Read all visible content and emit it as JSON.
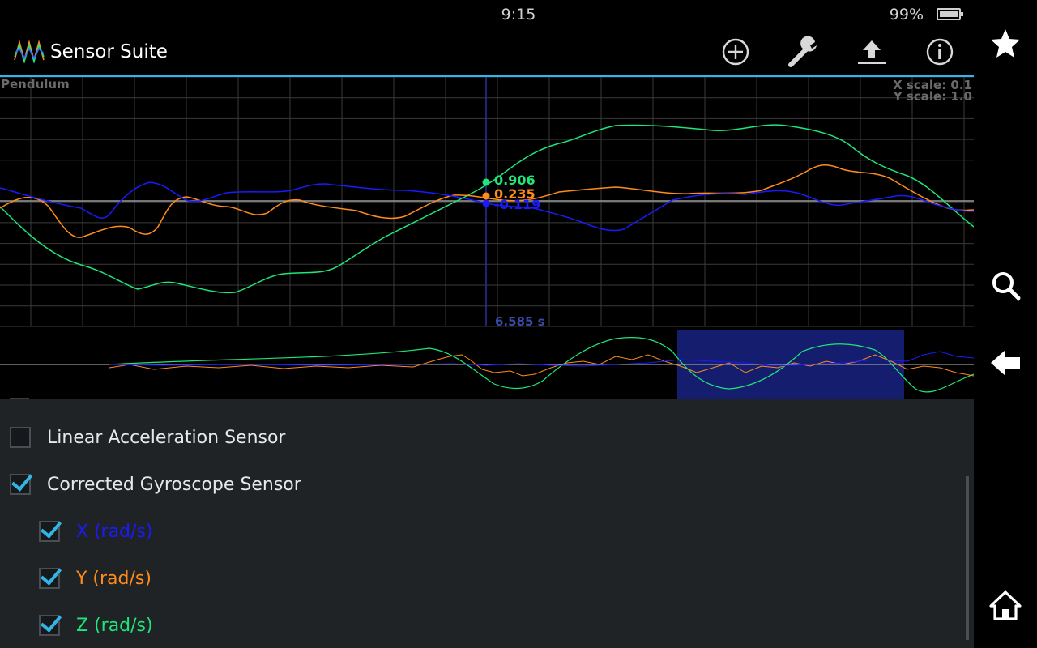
{
  "status": {
    "time": "9:15",
    "battery": "99%"
  },
  "app": {
    "title": "Sensor Suite"
  },
  "graph": {
    "title": "Pendulum",
    "x_scale": "X scale: 0.1",
    "y_scale": "Y scale: 1.0",
    "cursor_time": "6.585 s",
    "readouts": {
      "z": "0.906",
      "y": "0.235",
      "x": "-0.119"
    }
  },
  "colors": {
    "x": "#1a1aff",
    "y": "#ff8c1a",
    "z": "#1ee67a",
    "accent": "#33b5e5"
  },
  "sensors": [
    {
      "label": "Linear Acceleration Sensor",
      "checked": false
    },
    {
      "label": "Corrected Gyroscope Sensor",
      "checked": true
    }
  ],
  "axes": [
    {
      "label": "X (rad/s)",
      "checked": true
    },
    {
      "label": "Y (rad/s)",
      "checked": true
    },
    {
      "label": "Z (rad/s)",
      "checked": true
    }
  ],
  "icons": {
    "add": "add-circle-icon",
    "settings": "wrench-icon",
    "export": "upload-icon",
    "info": "info-icon",
    "favorite": "star-icon",
    "search": "search-icon",
    "back": "back-arrow-icon",
    "home": "home-icon"
  }
}
